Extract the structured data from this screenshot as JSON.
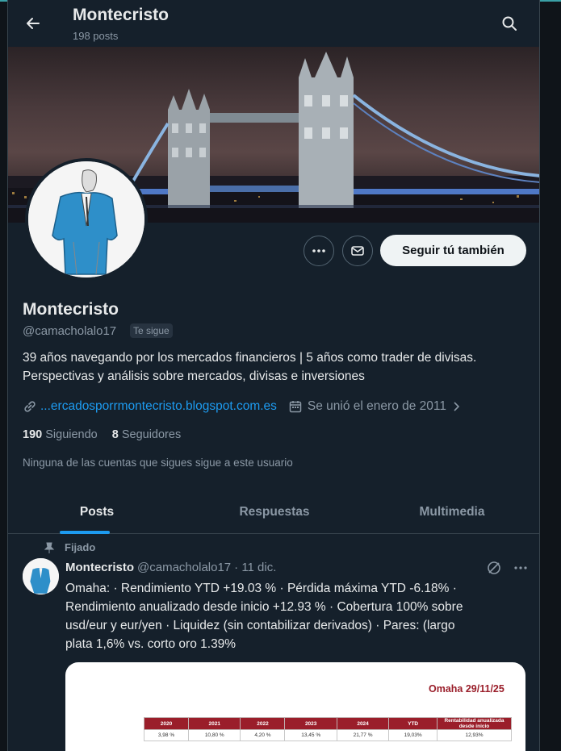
{
  "header": {
    "title": "Montecristo",
    "posts_count": "198 posts"
  },
  "profile": {
    "name": "Montecristo",
    "handle": "@camacholalo17",
    "follows_you": "Te sigue",
    "follow_button": "Seguir tú también",
    "bio_line1": "39 años navegando por los mercados financieros | 5 años como trader de divisas.",
    "bio_line2": "Perspectivas y análisis sobre mercados, divisas e inversiones",
    "website": "...ercadosporrmontecristo.blogspot.com.es",
    "joined": "Se unió el enero de 2011",
    "following_count": "190",
    "following_label": "Siguiendo",
    "followers_count": "8",
    "followers_label": "Seguidores",
    "no_mutuals": "Ninguna de las cuentas que sigues sigue a este usuario"
  },
  "tabs": [
    {
      "label": "Posts",
      "active": true
    },
    {
      "label": "Respuestas",
      "active": false
    },
    {
      "label": "Multimedia",
      "active": false
    }
  ],
  "post": {
    "pinned_label": "Fijado",
    "author": "Montecristo",
    "handle": "@camacholalo17",
    "date": "· 11 dic.",
    "line1": "Omaha:  · Rendimiento YTD  +19.03 %    · Pérdida máxima YTD -6.18%   ·",
    "line2": "Rendimiento anualizado desde inicio  +12.93 %    · Cobertura 100% sobre",
    "line3": "usd/eur y  eur/yen    · Liquidez (sin contabilizar derivados)    · Pares: (largo",
    "line4": "plata 1,6% vs. corto oro 1.39%"
  },
  "card": {
    "title": "Omaha 29/11/25",
    "headers": [
      "2020",
      "2021",
      "2022",
      "2023",
      "2024",
      "YTD",
      "Rentabilidad anualizada desde inicio"
    ],
    "values": [
      "3,98 %",
      "10,80 %",
      "4,20 %",
      "13,45 %",
      "21,77 %",
      "19,03%",
      "12,93%"
    ]
  },
  "colors": {
    "accent": "#1d9bf0",
    "background": "#15202b",
    "table_header": "#9a1e2a"
  }
}
